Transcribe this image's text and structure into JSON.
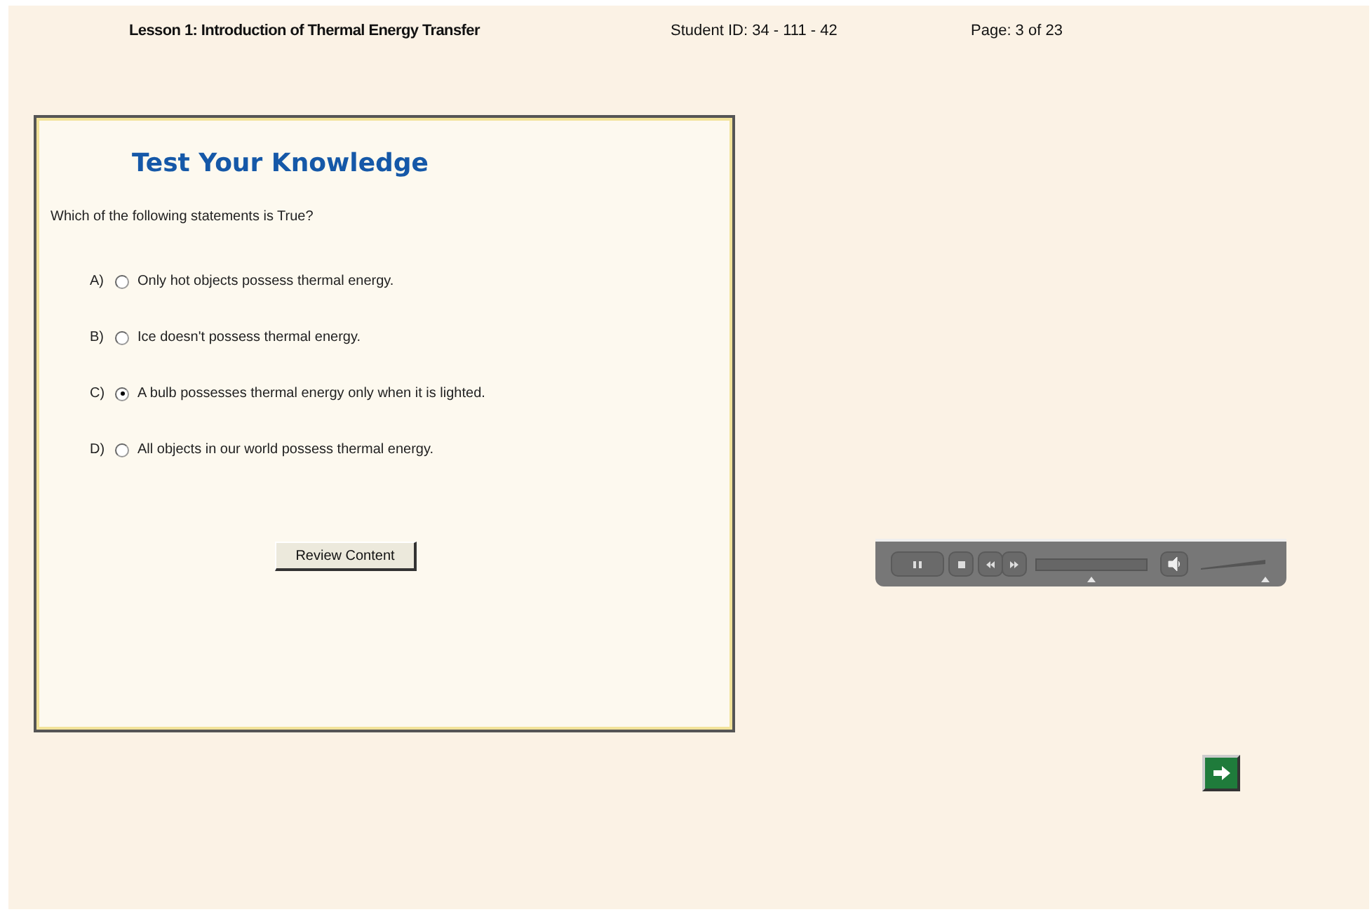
{
  "header": {
    "lesson": "Lesson 1:  Introduction of Thermal Energy Transfer",
    "student_id": "Student ID: 34 - 111 - 42",
    "page": "Page: 3 of 23"
  },
  "quiz": {
    "title": "Test Your Knowledge",
    "question": "Which  of the following statements is True?",
    "options": [
      {
        "letter": "A)",
        "text": "Only hot objects possess thermal energy.",
        "selected": false
      },
      {
        "letter": "B)",
        "text": "Ice doesn't possess thermal energy.",
        "selected": false
      },
      {
        "letter": "C)",
        "text": "A bulb possesses thermal energy  only when it is lighted.",
        "selected": true
      },
      {
        "letter": "D)",
        "text": "All objects in our world possess thermal energy.",
        "selected": false
      }
    ],
    "button": "Review Content"
  },
  "player": {
    "seek": {
      "level": 0.5
    },
    "volume": {
      "level": 1
    }
  }
}
